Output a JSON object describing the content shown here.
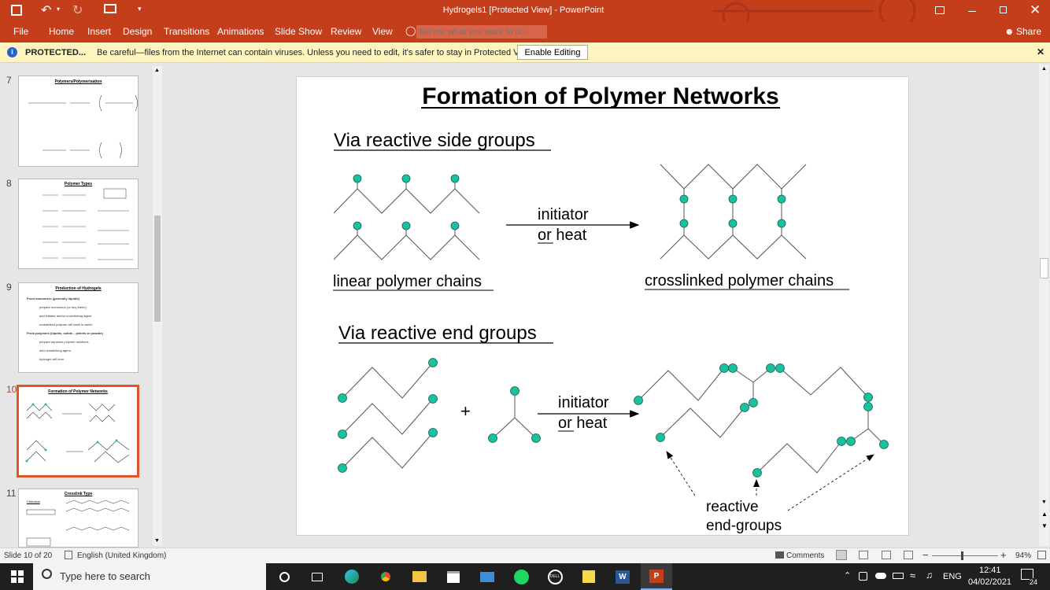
{
  "window": {
    "title": "Hydrogels1 [Protected View] - PowerPoint"
  },
  "ribbon": {
    "tabs": [
      "File",
      "Home",
      "Insert",
      "Design",
      "Transitions",
      "Animations",
      "Slide Show",
      "Review",
      "View"
    ],
    "search_placeholder": "Tell me what you want to do...",
    "share_label": "Share"
  },
  "protected_bar": {
    "label": "PROTECTED...",
    "message": "Be careful—files from the Internet can contain viruses. Unless you need to edit, it's safer to stay in Protected View.",
    "button": "Enable Editing"
  },
  "thumbnails": [
    {
      "number": "7",
      "title": "Polymers/Polymerisation"
    },
    {
      "number": "8",
      "title": "Polymer Types"
    },
    {
      "number": "9",
      "title": "Production of Hydrogels",
      "lines": [
        "From monomers (generally liquids)",
        "prepare monomers (or buy them!)",
        "add initiator and/or crosslinking agent",
        "crosslinked polymer will swell in water",
        "From polymers (liquids, solids – pellets or powder)",
        "prepare aqueous polymer solutions",
        "add crosslinking agent",
        "hydrogel will form"
      ]
    },
    {
      "number": "10",
      "title": "Formation of Polymer Networks"
    },
    {
      "number": "11",
      "title": "Crosslink Type",
      "lines": [
        "Chemical"
      ]
    }
  ],
  "slide": {
    "title": "Formation of Polymer Networks",
    "section1": "Via reactive side groups",
    "initiator": "initiator",
    "or_heat": "or heat",
    "or_word": "or",
    "heat_word": " heat",
    "linear_label": "linear polymer chains",
    "crosslinked_label": "crosslinked polymer chains",
    "section2": "Via reactive end groups",
    "plus": "+",
    "reactive_label_1": "reactive",
    "reactive_label_2": "end-groups",
    "node_color": "#17c2a0"
  },
  "status": {
    "slide_info": "Slide 10 of 20",
    "language": "English (United Kingdom)",
    "comments": "Comments",
    "zoom": "94%"
  },
  "taskbar": {
    "search_placeholder": "Type here to search",
    "lang": "ENG",
    "time": "12:41",
    "date": "04/02/2021",
    "notifications": "24"
  }
}
